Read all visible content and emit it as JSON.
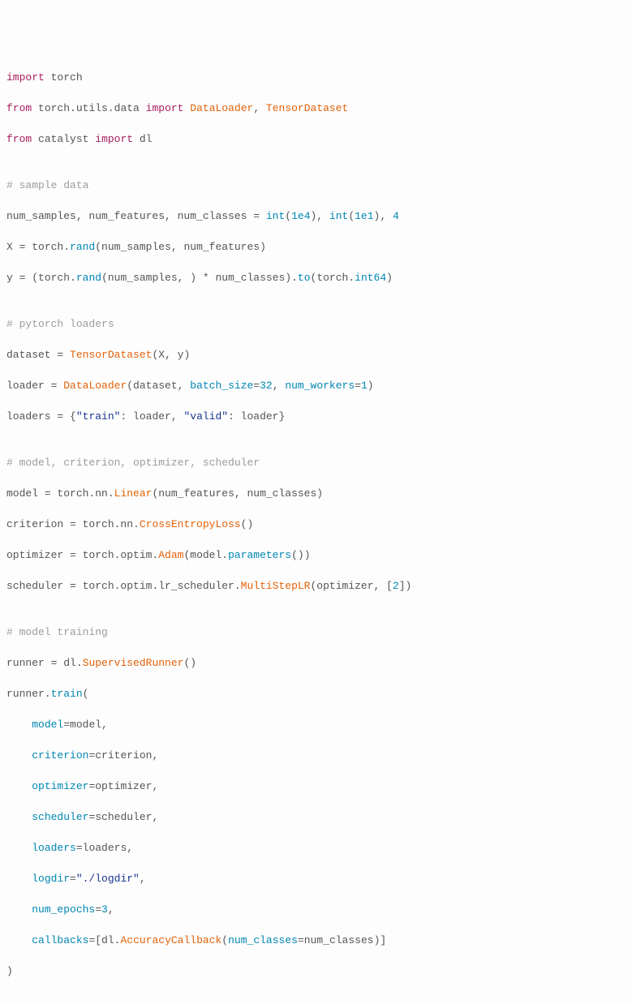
{
  "code": {
    "l01": {
      "kw_import": "import",
      "torch": "torch"
    },
    "l02": {
      "kw_from": "from",
      "path": "torch.utils.data",
      "kw_import": "import",
      "cls1": "DataLoader",
      "sep": ", ",
      "cls2": "TensorDataset"
    },
    "l03": {
      "kw_from": "from",
      "path": "catalyst",
      "kw_import": "import",
      "imp": "dl"
    },
    "l04": {
      "blank": ""
    },
    "l05": {
      "cmt": "# sample data"
    },
    "l06": {
      "lhs": "num_samples, num_features, num_classes ",
      "eq": "=",
      "sp": " ",
      "fn1": "int",
      "p1": "(",
      "n1": "1e4",
      "p2": "), ",
      "fn2": "int",
      "p3": "(",
      "n2": "1e1",
      "p4": "), ",
      "n3": "4"
    },
    "l07": {
      "var": "X ",
      "eq": "=",
      "rest": " torch.",
      "fn": "rand",
      "args": "(num_samples, num_features)"
    },
    "l08": {
      "var": "y ",
      "eq": "=",
      "sp": " (torch.",
      "fn": "rand",
      "mid": "(num_samples, ) ",
      "star": "*",
      "mid2": " num_classes).",
      "to": "to",
      "open": "(torch.",
      "int64": "int64",
      "close": ")"
    },
    "l09": {
      "blank": ""
    },
    "l10": {
      "cmt": "# pytorch loaders"
    },
    "l11": {
      "lhs": "dataset ",
      "eq": "=",
      "sp": " ",
      "cls": "TensorDataset",
      "args": "(X, y)"
    },
    "l12": {
      "lhs": "loader ",
      "eq": "=",
      "sp": " ",
      "cls": "DataLoader",
      "open": "(dataset, ",
      "kw1": "batch_size",
      "a1": "=",
      "n1": "32",
      "c1": ", ",
      "kw2": "num_workers",
      "a2": "=",
      "n2": "1",
      "close": ")"
    },
    "l13": {
      "lhs": "loaders ",
      "eq": "=",
      "sp": " {",
      "s1": "\"train\"",
      "c1": ": loader, ",
      "s2": "\"valid\"",
      "c2": ": loader}"
    },
    "l14": {
      "blank": ""
    },
    "l15": {
      "cmt": "# model, criterion, optimizer, scheduler"
    },
    "l16": {
      "lhs": "model ",
      "eq": "=",
      "mid": " torch.nn.",
      "cls": "Linear",
      "args": "(num_features, num_classes)"
    },
    "l17": {
      "lhs": "criterion ",
      "eq": "=",
      "mid": " torch.nn.",
      "cls": "CrossEntropyLoss",
      "args": "()"
    },
    "l18": {
      "lhs": "optimizer ",
      "eq": "=",
      "mid": " torch.optim.",
      "cls": "Adam",
      "open": "(model.",
      "fn": "parameters",
      "close": "())"
    },
    "l19": {
      "lhs": "scheduler ",
      "eq": "=",
      "mid": " torch.optim.lr_scheduler.",
      "cls": "MultiStepLR",
      "open": "(optimizer, [",
      "n": "2",
      "close": "])"
    },
    "l20": {
      "blank": ""
    },
    "l21": {
      "cmt": "# model training"
    },
    "l22": {
      "lhs": "runner ",
      "eq": "=",
      "mid": " dl.",
      "cls": "SupervisedRunner",
      "args": "()"
    },
    "l23": {
      "lhs": "runner.",
      "fn": "train",
      "open": "("
    },
    "l24": {
      "indent": "    ",
      "kw": "model",
      "eq": "=",
      "val": "model,"
    },
    "l25": {
      "indent": "    ",
      "kw": "criterion",
      "eq": "=",
      "val": "criterion,"
    },
    "l26": {
      "indent": "    ",
      "kw": "optimizer",
      "eq": "=",
      "val": "optimizer,"
    },
    "l27": {
      "indent": "    ",
      "kw": "scheduler",
      "eq": "=",
      "val": "scheduler,"
    },
    "l28": {
      "indent": "    ",
      "kw": "loaders",
      "eq": "=",
      "val": "loaders,"
    },
    "l29": {
      "indent": "    ",
      "kw": "logdir",
      "eq": "=",
      "str": "\"./logdir\"",
      "c": ","
    },
    "l30": {
      "indent": "    ",
      "kw": "num_epochs",
      "eq": "=",
      "n": "3",
      "c": ","
    },
    "l31": {
      "indent": "    ",
      "kw": "callbacks",
      "eq": "=",
      "open": "[dl.",
      "cls": "AccuracyCallback",
      "p1": "(",
      "kw2": "num_classes",
      "eq2": "=",
      "val": "num_classes)]"
    },
    "l32": {
      "close": ")"
    }
  }
}
